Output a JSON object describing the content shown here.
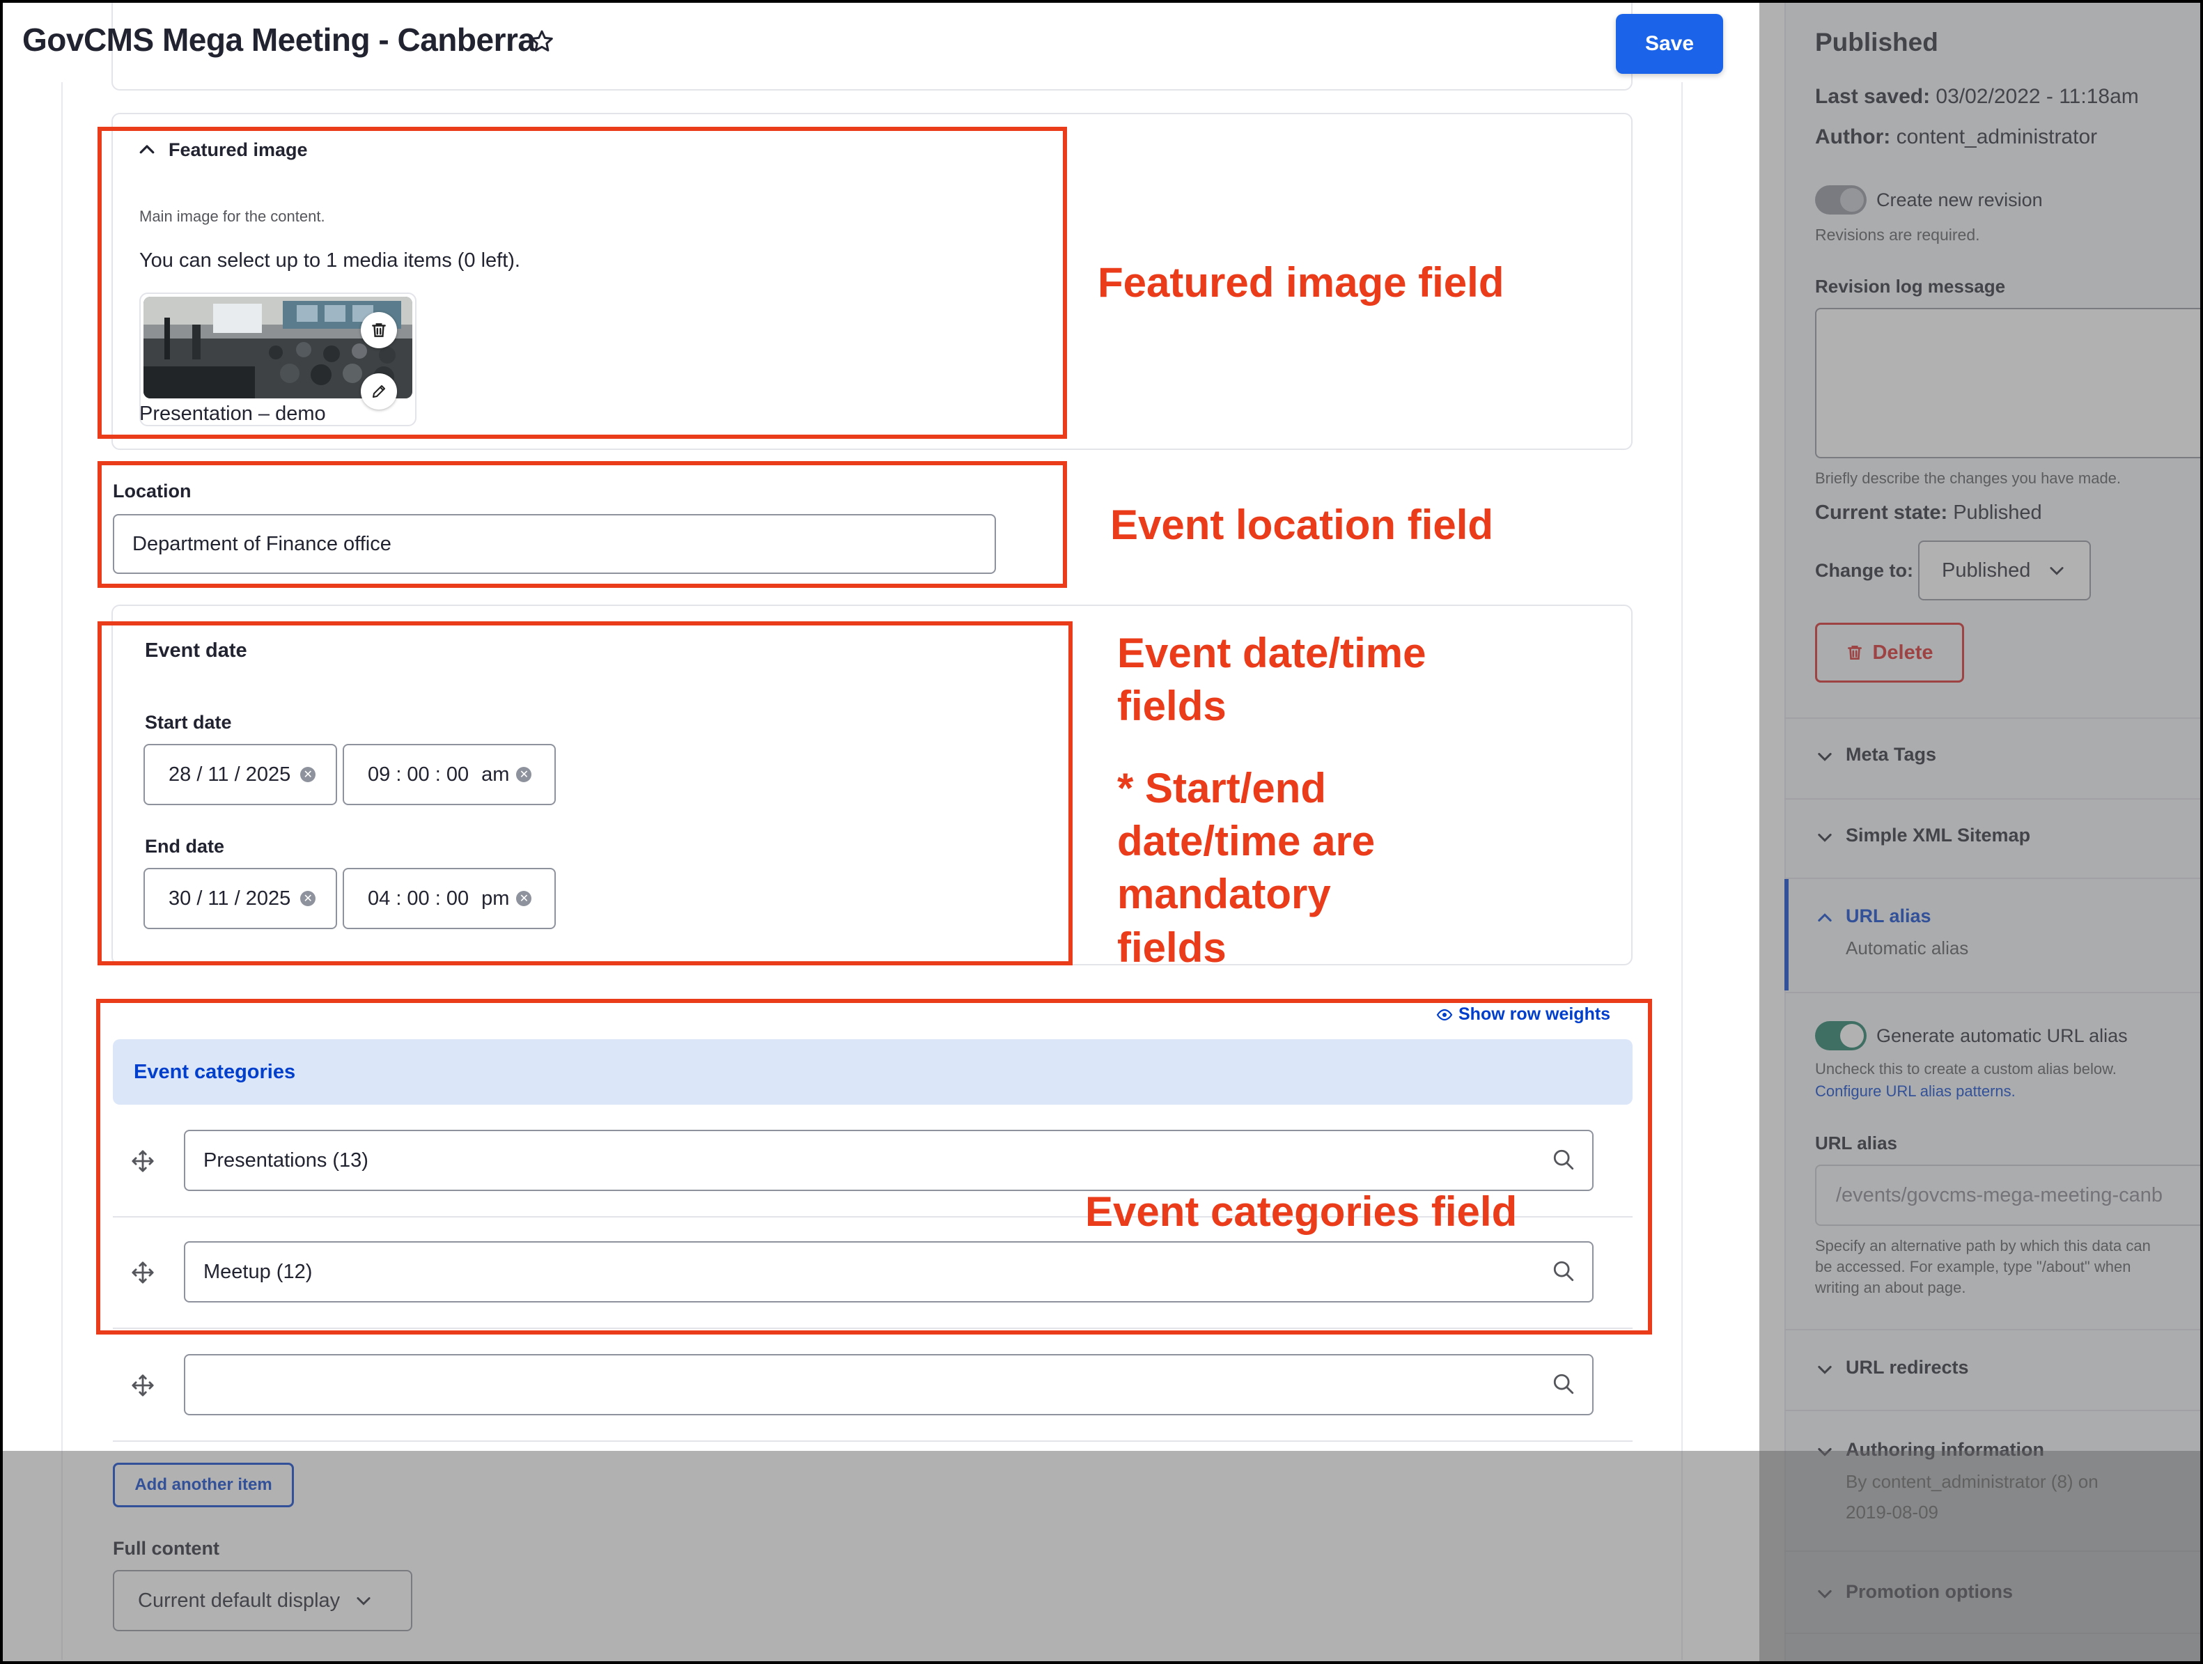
{
  "header": {
    "title": "GovCMS Mega Meeting - Canberra",
    "save_label": "Save"
  },
  "featured_image": {
    "heading": "Featured image",
    "description": "Main image for the content.",
    "limit_text": "You can select up to 1 media items (0 left).",
    "media_name": "Presentation – demo"
  },
  "location": {
    "label": "Location",
    "value": "Department of Finance office"
  },
  "event_date": {
    "heading": "Event date",
    "start_label": "Start date",
    "start_date": "28 / 11 / 2025",
    "start_time": "09 : 00 : 00",
    "start_ampm": "am",
    "end_label": "End date",
    "end_date": "30 / 11 / 2025",
    "end_time": "04 : 00 : 00",
    "end_ampm": "pm"
  },
  "categories": {
    "show_weights": "Show row weights",
    "heading": "Event categories",
    "items": [
      "Presentations (13)",
      "Meetup (12)",
      ""
    ],
    "add_another": "Add another item"
  },
  "full_content": {
    "label": "Full content",
    "value": "Current default display"
  },
  "annotations": {
    "featured": "Featured image field",
    "location": "Event location field",
    "date_line1": "Event date/time",
    "date_line2": "fields",
    "mandatory_line1": "* Start/end",
    "mandatory_line2": "date/time are",
    "mandatory_line3": "mandatory",
    "mandatory_line4": "fields",
    "categories": "Event categories field"
  },
  "sidebar": {
    "status": "Published",
    "last_saved_label": "Last saved:",
    "last_saved_value": "03/02/2022 - 11:18am",
    "author_label": "Author:",
    "author_value": "content_administrator",
    "create_revision": "Create new revision",
    "revisions_required": "Revisions are required.",
    "revision_log_label": "Revision log message",
    "revision_log_help": "Briefly describe the changes you have made.",
    "current_state_label": "Current state:",
    "current_state_value": "Published",
    "change_to_label": "Change to:",
    "change_to_value": "Published",
    "delete_label": "Delete",
    "meta_tags": "Meta Tags",
    "sitemap": "Simple XML Sitemap",
    "url_alias_heading": "URL alias",
    "url_alias_summary": "Automatic alias",
    "generate_alias": "Generate automatic URL alias",
    "uncheck_help": "Uncheck this to create a custom alias below.",
    "configure_link": "Configure URL alias patterns.",
    "url_alias_label": "URL alias",
    "url_alias_value": "/events/govcms-mega-meeting-canb",
    "alias_help1": "Specify an alternative path by which this data can",
    "alias_help2": "be accessed. For example, type \"/about\" when",
    "alias_help3": "writing an about page.",
    "url_redirects": "URL redirects",
    "authoring": "Authoring information",
    "authoring_summary1": "By content_administrator (8) on",
    "authoring_summary2": "2019-08-09",
    "promotion": "Promotion options"
  },
  "colors": {
    "primary": "#1b63e8",
    "annotation": "#ea3b1b",
    "danger": "#d72222",
    "toggle_on": "#1a7a62"
  }
}
